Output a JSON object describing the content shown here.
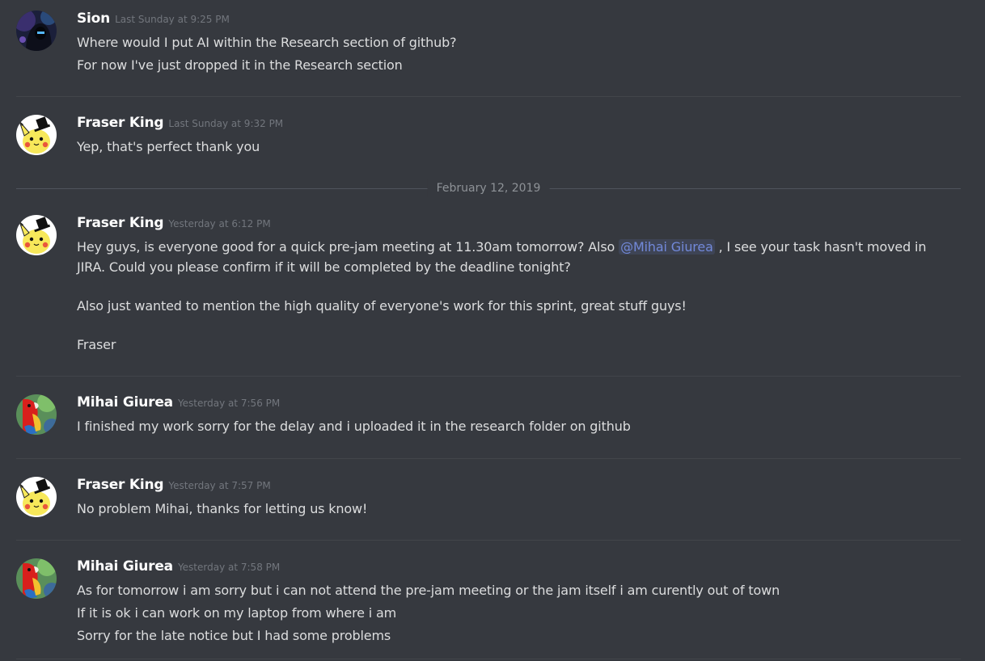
{
  "colors": {
    "background": "#36393f",
    "author": "#ffffff",
    "message_text": "#dcddde",
    "timestamp": "#72767d",
    "mention": "#7289da",
    "separator": "#42454a"
  },
  "date_divider": "February 12, 2019",
  "messages": [
    {
      "avatar_icon": "hooded-figure-avatar",
      "author": "Sion",
      "timestamp": "Last Sunday at 9:25 PM",
      "lines": [
        "Where would I put AI within the Research section of github?",
        "For now I've just dropped it in the Research section"
      ]
    },
    {
      "avatar_icon": "pikachu-top-hat-avatar",
      "author": "Fraser King",
      "timestamp": "Last Sunday at 9:32 PM",
      "lines": [
        "Yep, that's perfect thank you"
      ]
    },
    {
      "avatar_icon": "pikachu-top-hat-avatar",
      "author": "Fraser King",
      "timestamp": "Yesterday at 6:12 PM",
      "lines": [
        "Hey guys, is everyone good for a quick pre-jam meeting at 11.30am tomorrow? Also",
        "@Mihai Giurea",
        ", I see your task hasn't moved in",
        "JIRA. Could you please confirm if it will be completed by the deadline tonight?",
        "Also just wanted to mention the high quality of everyone's work for this sprint, great stuff guys!",
        "Fraser"
      ]
    },
    {
      "avatar_icon": "parrot-avatar",
      "author": "Mihai Giurea",
      "timestamp": "Yesterday at 7:56 PM",
      "lines": [
        "I finished my work sorry for the delay and i uploaded it in the research folder on github"
      ]
    },
    {
      "avatar_icon": "pikachu-top-hat-avatar",
      "author": "Fraser King",
      "timestamp": "Yesterday at 7:57 PM",
      "lines": [
        "No problem Mihai, thanks for letting us know!"
      ]
    },
    {
      "avatar_icon": "parrot-avatar",
      "author": "Mihai Giurea",
      "timestamp": "Yesterday at 7:58 PM",
      "lines": [
        "As for tomorrow i am sorry but i can not attend the pre-jam meeting or the jam itself i am curently out of town",
        "If it is ok i can work on my laptop from where i am",
        "Sorry for the late notice but I had some problems"
      ]
    }
  ]
}
